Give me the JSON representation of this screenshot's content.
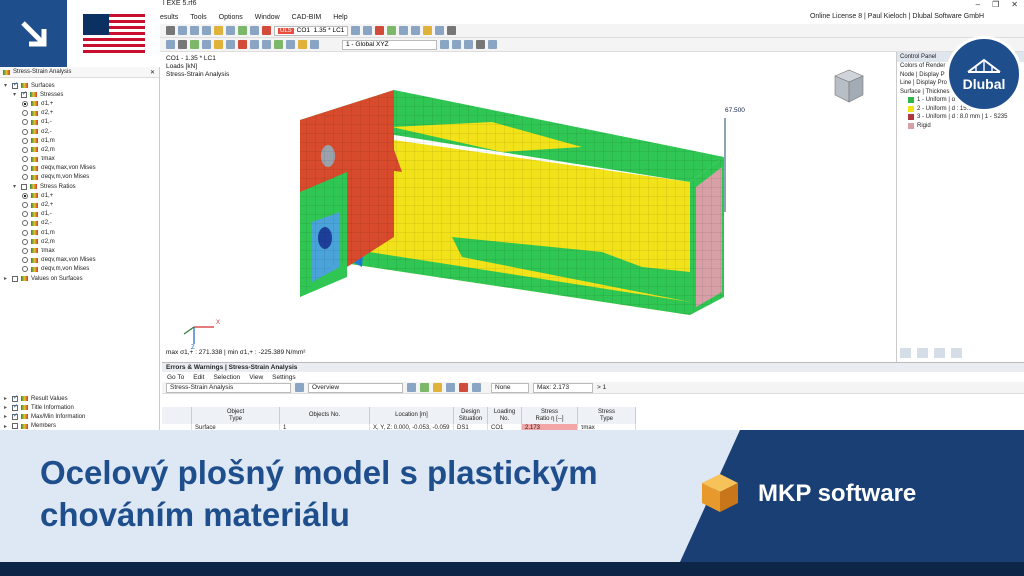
{
  "app": {
    "file_title": "l EXE 5.rf6",
    "menu": [
      "esults",
      "Tools",
      "Options",
      "Window",
      "CAD-BIM",
      "Help"
    ],
    "license": "Online License 8 | Paul Kieloch | Dlubal Software GmbH",
    "combo_loadcase": "CO1",
    "combo_loadcase_desc": "1.35 * LC1",
    "uls_badge": "ULS",
    "view_combo": "1 - Global XYZ"
  },
  "navigator": {
    "title": "Stress-Strain Analysis",
    "items": [
      {
        "label": "Surfaces",
        "level": 0,
        "check": "on",
        "expand": "▾",
        "icon": true
      },
      {
        "label": "Stresses",
        "level": 1,
        "check": "on",
        "expand": "▾",
        "icon": true
      },
      {
        "label": "σ1,+",
        "level": 2,
        "radio": "on"
      },
      {
        "label": "σ2,+",
        "level": 2,
        "radio": "off"
      },
      {
        "label": "σ1,-",
        "level": 2,
        "radio": "off"
      },
      {
        "label": "σ2,-",
        "level": 2,
        "radio": "off"
      },
      {
        "label": "σ1,m",
        "level": 2,
        "radio": "off"
      },
      {
        "label": "σ2,m",
        "level": 2,
        "radio": "off"
      },
      {
        "label": "τmax",
        "level": 2,
        "radio": "off"
      },
      {
        "label": "σeqv,max,von Mises",
        "level": 2,
        "radio": "off"
      },
      {
        "label": "σeqv,m,von Mises",
        "level": 2,
        "radio": "off"
      },
      {
        "label": "Stress Ratios",
        "level": 1,
        "check": "off",
        "expand": "▾",
        "icon": true
      },
      {
        "label": "σ1,+",
        "level": 2,
        "radio": "on"
      },
      {
        "label": "σ2,+",
        "level": 2,
        "radio": "off"
      },
      {
        "label": "σ1,-",
        "level": 2,
        "radio": "off"
      },
      {
        "label": "σ2,-",
        "level": 2,
        "radio": "off"
      },
      {
        "label": "σ1,m",
        "level": 2,
        "radio": "off"
      },
      {
        "label": "σ2,m",
        "level": 2,
        "radio": "off"
      },
      {
        "label": "τmax",
        "level": 2,
        "radio": "off"
      },
      {
        "label": "σeqv,max,von Mises",
        "level": 2,
        "radio": "off"
      },
      {
        "label": "σeqv,m,von Mises",
        "level": 2,
        "radio": "off"
      },
      {
        "label": "Values on Surfaces",
        "level": 0,
        "check": "off",
        "expand": "▸",
        "icon": true
      }
    ],
    "bottom_items": [
      {
        "label": "Result Values",
        "check": "on"
      },
      {
        "label": "Title Information",
        "check": "on"
      },
      {
        "label": "Max/Min Information",
        "check": "on"
      },
      {
        "label": "Members",
        "check": "off"
      }
    ]
  },
  "viewport": {
    "info_lines": [
      "CO1 - 1.35 * LC1",
      "Loads [kN]",
      "Stress-Strain Analysis"
    ],
    "annotation": "67.500",
    "footer": "max σ1,+ : 271.338 | min σ1,+ : -225.389 N/mm²",
    "axis_x": "X",
    "axis_z": "Z"
  },
  "control_panel": {
    "title": "Control Panel",
    "rows": [
      {
        "text": "Colors of Render"
      },
      {
        "text": "Node | Display P"
      },
      {
        "text": "Line | Display Pro"
      },
      {
        "text": "Surface | Thicknes"
      }
    ],
    "legend": [
      {
        "text": "1 - Uniform | d",
        "color": "#2fb84a"
      },
      {
        "text": "2 - Uniform | d : 15.0",
        "color": "#f2e21a"
      },
      {
        "text": "3 - Uniform | d : 8.0 mm | 1 - S235",
        "color": "#b0363d"
      },
      {
        "text": "Rigid",
        "color": "#d6a0a6"
      }
    ]
  },
  "brand": {
    "name": "Dlubal"
  },
  "results": {
    "header": "Errors & Warnings | Stress-Strain Analysis",
    "menu": [
      "Go To",
      "Edit",
      "Selection",
      "View",
      "Settings"
    ],
    "module": "Stress-Strain Analysis",
    "overview": "Overview",
    "filter": "None",
    "max_label": "Max: 2.173",
    "page": "> 1",
    "columns": [
      "",
      "Object\nType",
      "Objects No.",
      "Location [m]",
      "Design\nSituation",
      "Loading\nNo.",
      "Stress\nRatio η [--]",
      "Stress\nType"
    ],
    "row": [
      "",
      "Surface",
      "1",
      "X, Y, Z: 0.000, -0.053, -0.059",
      "DS1",
      "CO1",
      "2.173",
      "τmax"
    ]
  },
  "banner": {
    "title_line1": "Ocelový plošný model s plastickým",
    "title_line2": "chováním materiálu",
    "tag": "MKP software"
  }
}
